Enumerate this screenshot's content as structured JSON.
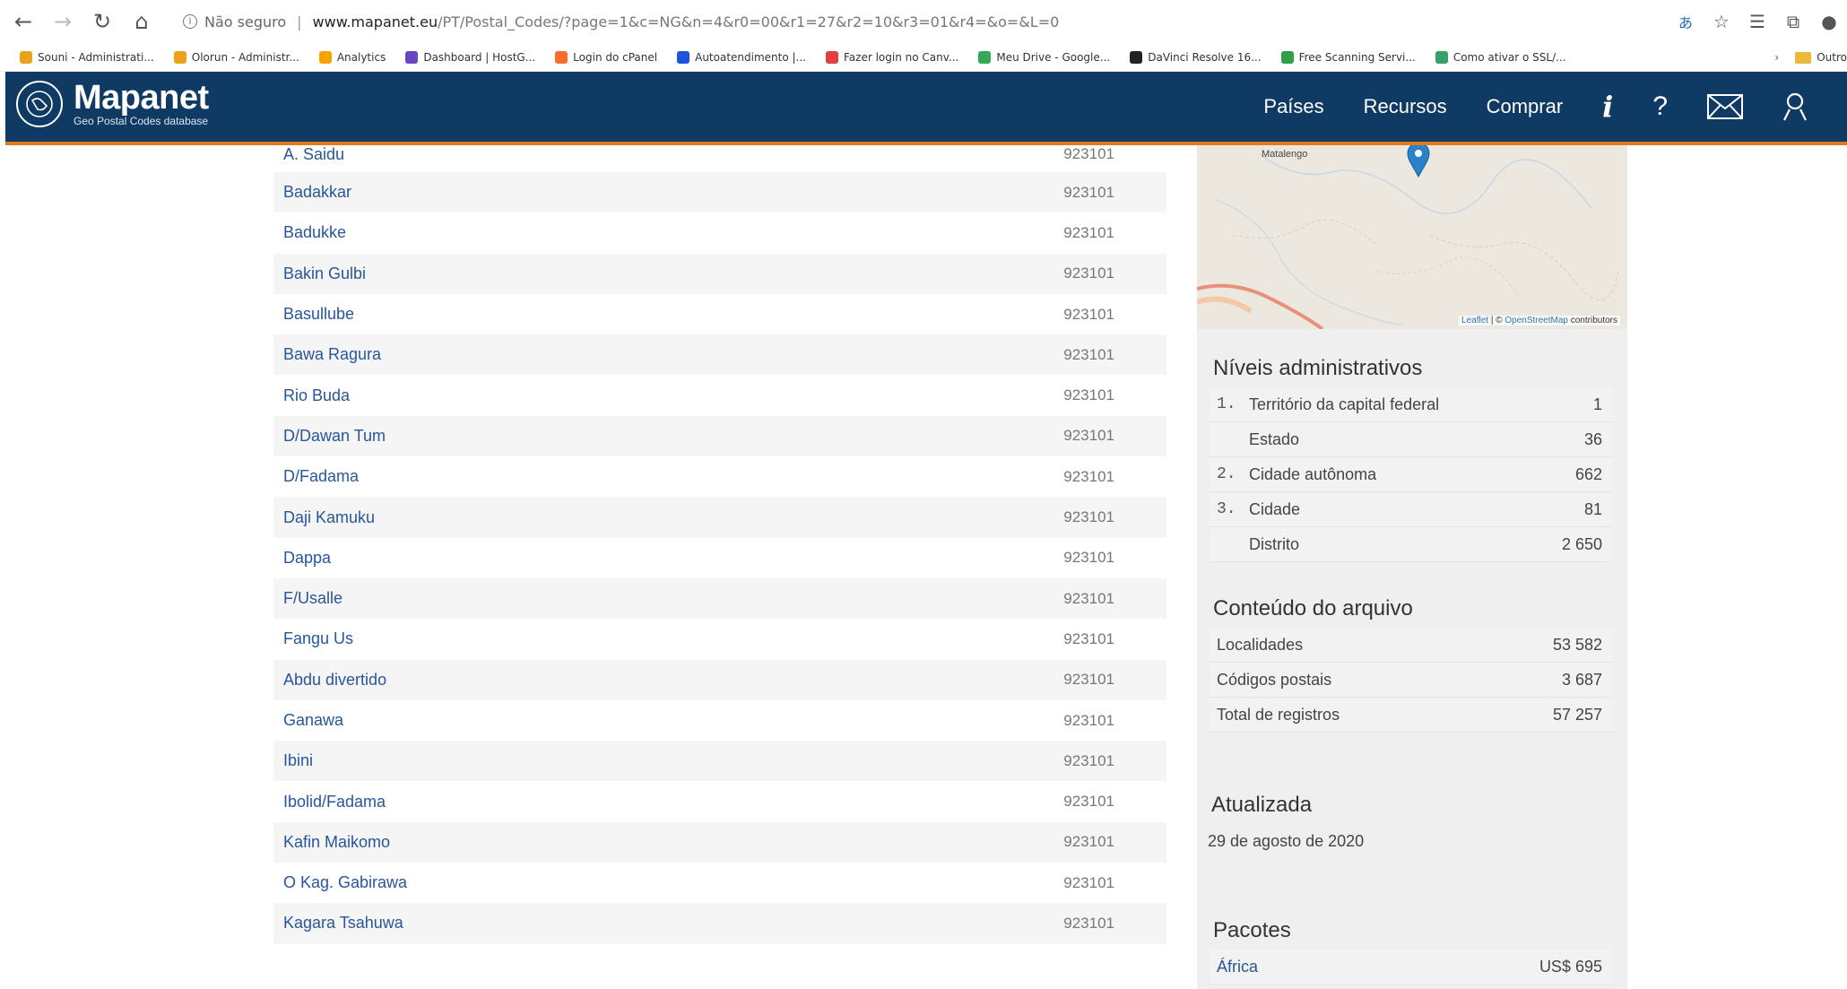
{
  "browser": {
    "security_label": "Não seguro",
    "url_host": "www.mapanet.eu",
    "url_path": "/PT/Postal_Codes/?page=1&c=NG&n=4&r0=00&r1=27&r2=10&r3=01&r4=&o=&L=0",
    "bookmarks": [
      {
        "label": "Souni - Administrati...",
        "color": "#e8a21c"
      },
      {
        "label": "Olorun - Administr...",
        "color": "#e8a21c"
      },
      {
        "label": "Analytics",
        "color": "#f4a300"
      },
      {
        "label": "Dashboard | HostG...",
        "color": "#6b46c1"
      },
      {
        "label": "Login do cPanel",
        "color": "#ff6c2c"
      },
      {
        "label": "Autoatendimento |...",
        "color": "#1a56db"
      },
      {
        "label": "Fazer login no Canv...",
        "color": "#e53e3e"
      },
      {
        "label": "Meu Drive - Google...",
        "color": "#34a853"
      },
      {
        "label": "DaVinci Resolve 16...",
        "color": "#222222"
      },
      {
        "label": "Free Scanning Servi...",
        "color": "#2f9e44"
      },
      {
        "label": "Como ativar o SSL/...",
        "color": "#38a169"
      }
    ],
    "other_bookmarks": "Outro"
  },
  "header": {
    "logo_title": "Mapanet",
    "logo_subtitle": "Geo Postal Codes database",
    "nav": [
      "Países",
      "Recursos",
      "Comprar"
    ],
    "icons": {
      "info": "i",
      "help": "?"
    }
  },
  "rows": [
    {
      "name": "A. Saidu",
      "code": "923101"
    },
    {
      "name": "Badakkar",
      "code": "923101"
    },
    {
      "name": "Badukke",
      "code": "923101"
    },
    {
      "name": "Bakin Gulbi",
      "code": "923101"
    },
    {
      "name": "Basullube",
      "code": "923101"
    },
    {
      "name": "Bawa Ragura",
      "code": "923101"
    },
    {
      "name": "Rio Buda",
      "code": "923101"
    },
    {
      "name": "D/Dawan Tum",
      "code": "923101"
    },
    {
      "name": "D/Fadama",
      "code": "923101"
    },
    {
      "name": "Daji Kamuku",
      "code": "923101"
    },
    {
      "name": "Dappa",
      "code": "923101"
    },
    {
      "name": "F/Usalle",
      "code": "923101"
    },
    {
      "name": "Fangu Us",
      "code": "923101"
    },
    {
      "name": "Abdu divertido",
      "code": "923101"
    },
    {
      "name": "Ganawa",
      "code": "923101"
    },
    {
      "name": "Ibini",
      "code": "923101"
    },
    {
      "name": "Ibolid/Fadama",
      "code": "923101"
    },
    {
      "name": "Kafin Maikomo",
      "code": "923101"
    },
    {
      "name": "O Kag. Gabirawa",
      "code": "923101"
    },
    {
      "name": "Kagara Tsahuwa",
      "code": "923101"
    }
  ],
  "map": {
    "place_label": "Matalengo",
    "attribution_leaflet": "Leaflet",
    "attribution_sep": " | © ",
    "attribution_osm": "OpenStreetMap",
    "attribution_tail": " contributors"
  },
  "admin_levels": {
    "title": "Níveis administrativos",
    "items": [
      {
        "num": "1.",
        "label": "Território da capital federal",
        "value": "1"
      },
      {
        "num": "",
        "label": "Estado",
        "value": "36"
      },
      {
        "num": "2.",
        "label": "Cidade autônoma",
        "value": "662"
      },
      {
        "num": "3.",
        "label": "Cidade",
        "value": "81"
      },
      {
        "num": "",
        "label": "Distrito",
        "value": "2 650"
      }
    ]
  },
  "file_contents": {
    "title": "Conteúdo do arquivo",
    "items": [
      {
        "label": "Localidades",
        "value": "53 582"
      },
      {
        "label": "Códigos postais",
        "value": "3 687"
      },
      {
        "label": "Total de registros",
        "value": "57 257"
      }
    ]
  },
  "updated": {
    "title": "Atualizada",
    "date": "29 de agosto de 2020"
  },
  "packages": {
    "title": "Pacotes",
    "items": [
      {
        "label": "África",
        "value": "US$ 695"
      }
    ]
  },
  "colors": {
    "header_bg": "#0e3a64",
    "header_accent": "#e07a1f",
    "link": "#28569a"
  }
}
